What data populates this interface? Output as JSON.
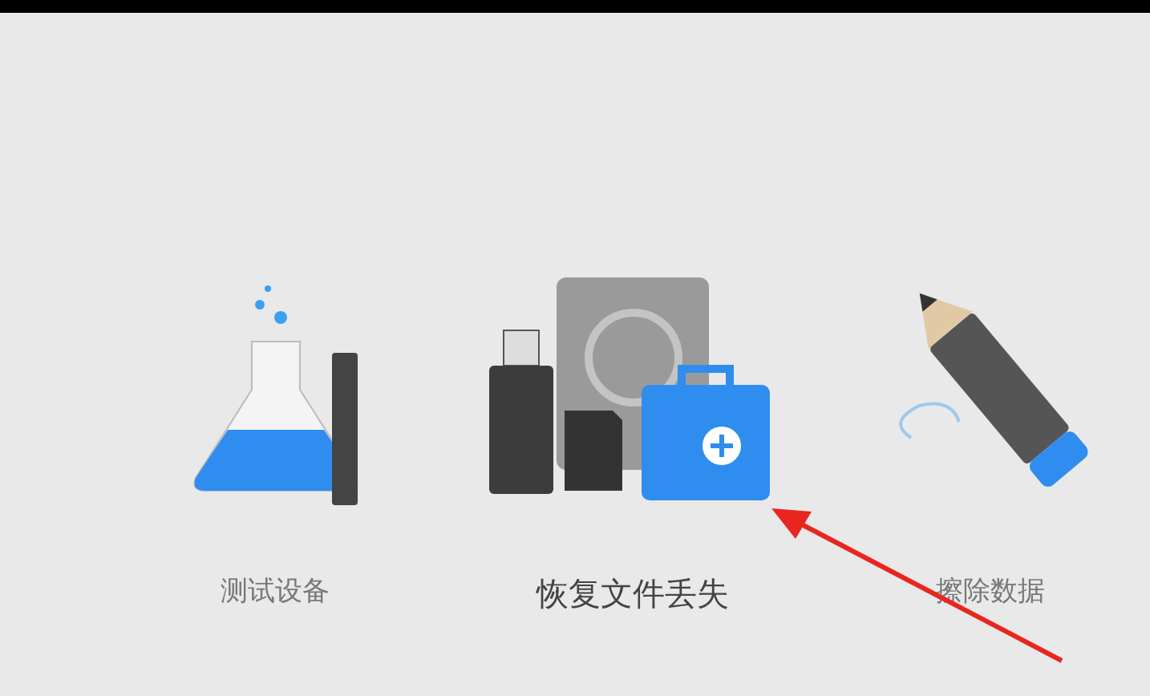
{
  "options": [
    {
      "kind": "test",
      "label": "测试设备",
      "selected": false
    },
    {
      "kind": "recover",
      "label": "恢复文件丢失",
      "selected": true
    },
    {
      "kind": "erase",
      "label": "擦除数据",
      "selected": false
    }
  ]
}
